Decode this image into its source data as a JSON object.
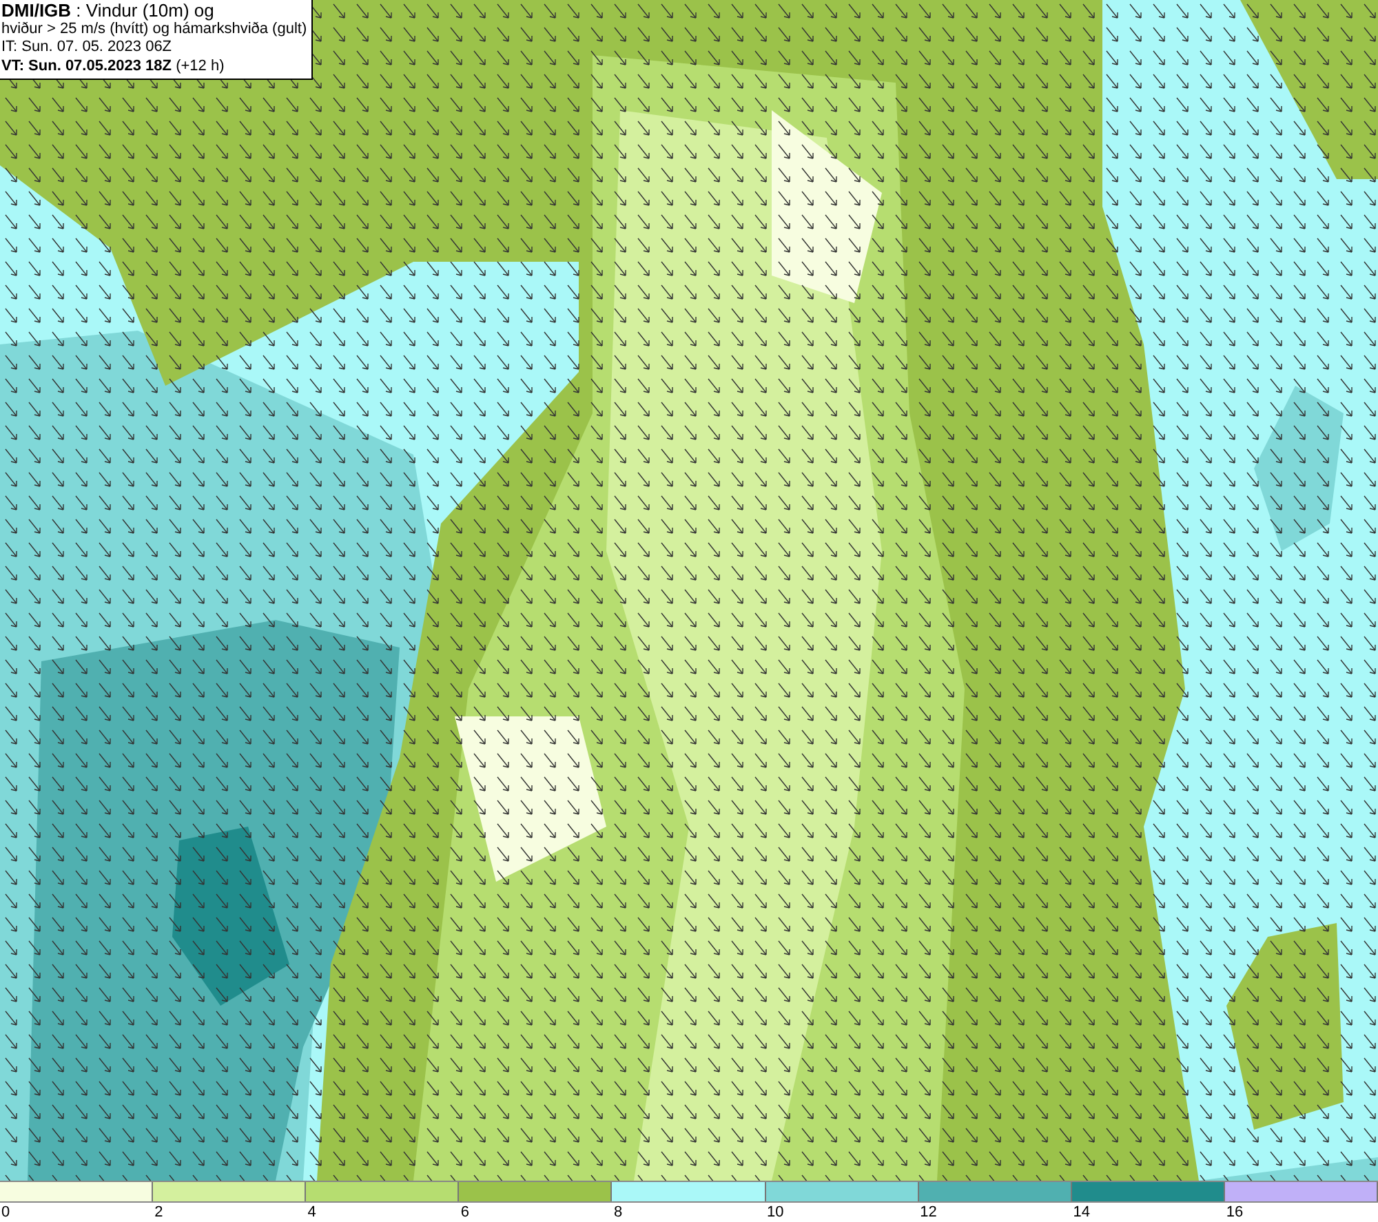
{
  "title_box": {
    "lines": [
      "**DMI/IGB** : Vindur (10m) og",
      "hviður > 25 m/s (hvítt) og hámarkshviða (gult)",
      "IT: Sun. 07. 05. 2023 06Z",
      "**VT: Sun. 07.05.2023 18Z** (+12 h)"
    ]
  },
  "legend": {
    "bins": [
      {
        "color": "#f7fde0",
        "label": "0"
      },
      {
        "color": "#d4f09e",
        "label": "2"
      },
      {
        "color": "#b6dd70",
        "label": "4"
      },
      {
        "color": "#9bc24a",
        "label": "6"
      },
      {
        "color": "#aaf8f8",
        "label": "8"
      },
      {
        "color": "#80d8d8",
        "label": "10"
      },
      {
        "color": "#50b0b0",
        "label": "12"
      },
      {
        "color": "#208c8c",
        "label": "14"
      },
      {
        "color": "#c0b0f8",
        "label": "16"
      }
    ]
  }
}
